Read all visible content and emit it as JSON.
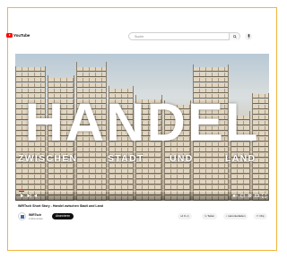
{
  "header": {
    "logo_text": "YouTube",
    "search_placeholder": "Suche"
  },
  "video": {
    "title_overlay": "HANDEL",
    "subtitle_words": [
      "ZWISCHEN",
      "STADT",
      "UND",
      "LAND"
    ],
    "progress_fraction": 0.02
  },
  "details": {
    "title": "WIRTsch Short Story - Handel zwischen Stadt und Land",
    "channel_name": "WIRTsch",
    "channel_subs": "2 Abonnenten",
    "subscribe_label": "Abonnieren",
    "actions": {
      "like_count": "0",
      "share_label": "Teilen",
      "download_label": "Herunterladen",
      "clip_label": "Clip"
    }
  },
  "colors": {
    "frame_border": "#f2b53a",
    "accent_red": "#ff0000"
  }
}
